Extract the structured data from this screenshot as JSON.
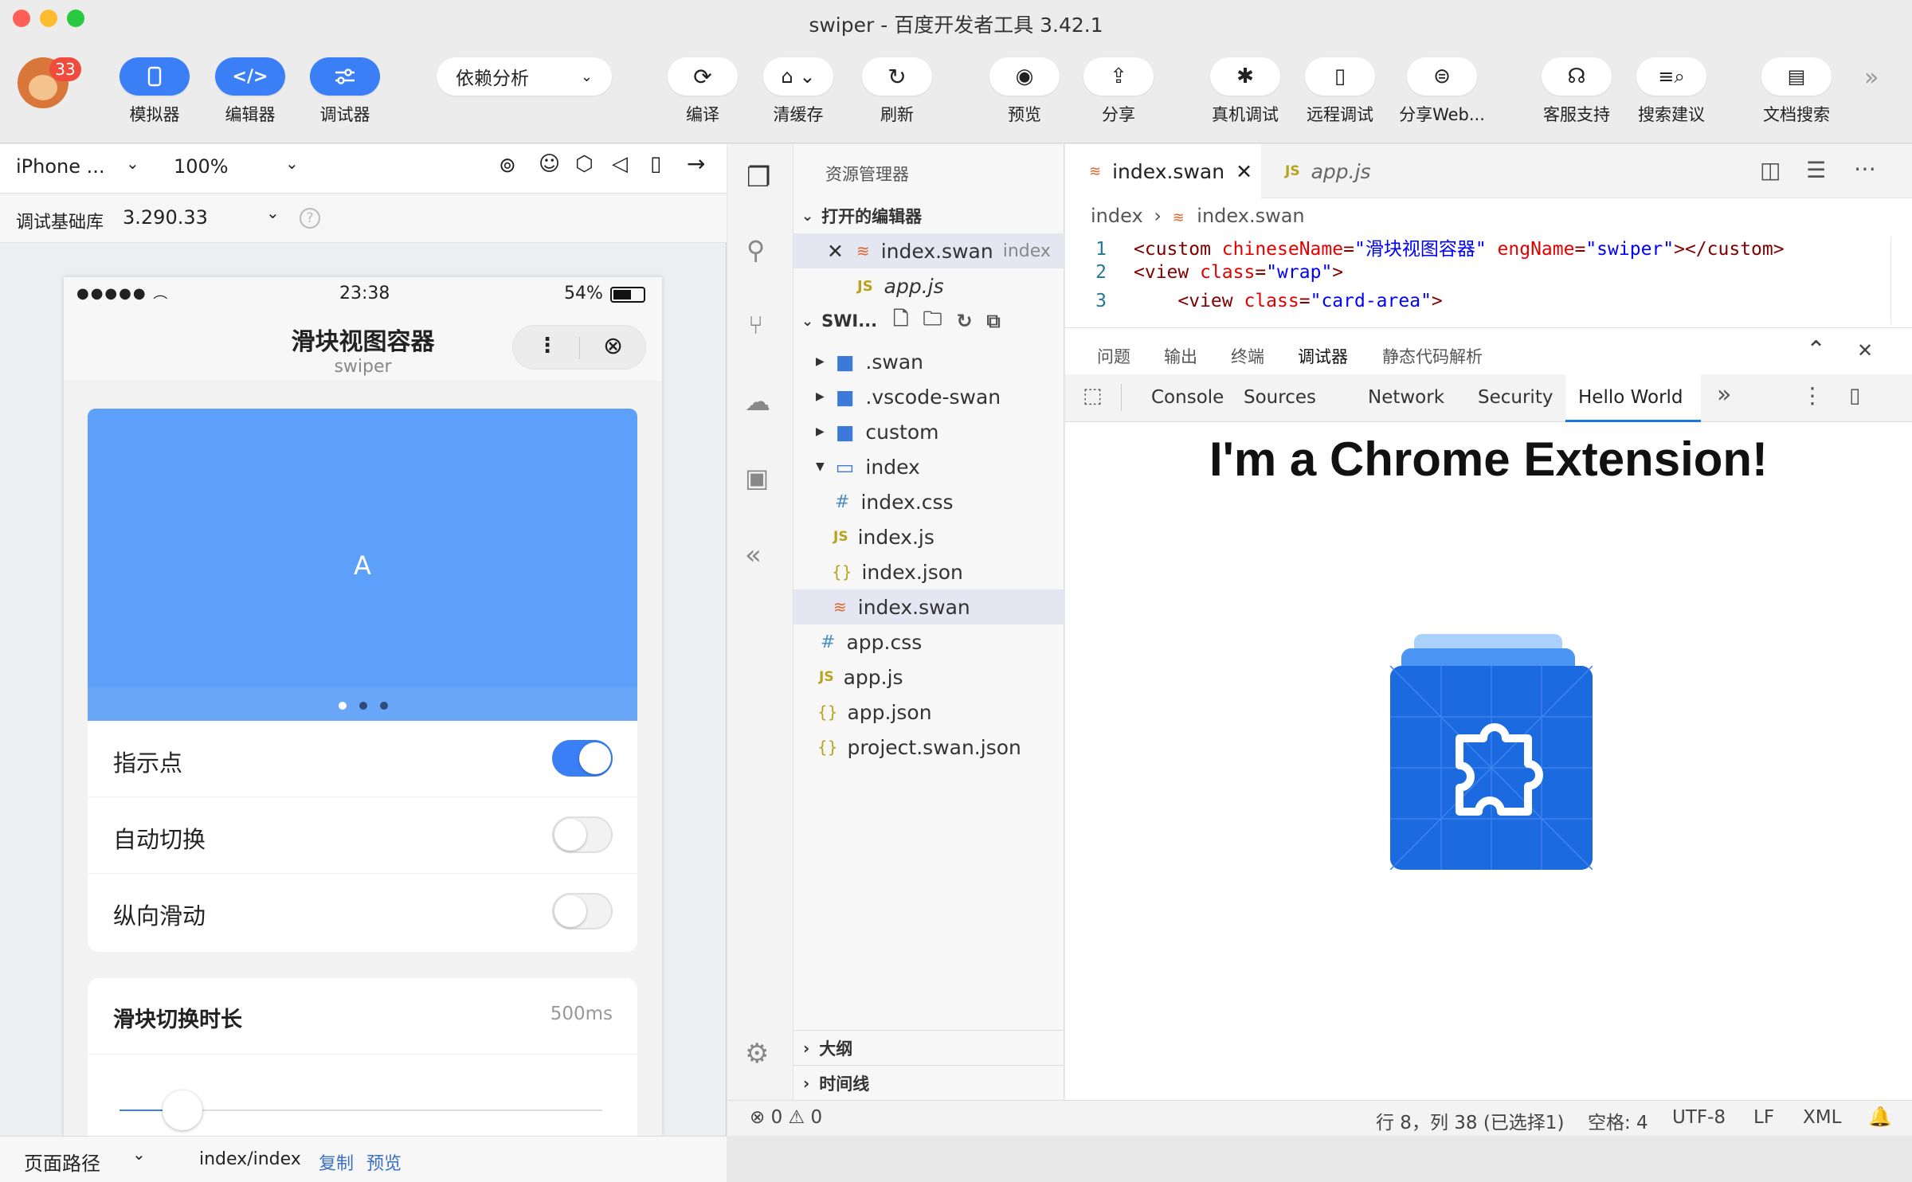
{
  "window": {
    "title": "swiper - 百度开发者工具 3.42.1",
    "badge": "33"
  },
  "toolbar": {
    "simulator": "模拟器",
    "editor": "编辑器",
    "debugger": "调试器",
    "dependency": "依赖分析",
    "compile": "编译",
    "clear_cache": "清缓存",
    "refresh": "刷新",
    "preview": "预览",
    "share": "分享",
    "real_debug": "真机调试",
    "remote_debug": "远程调试",
    "share_web": "分享Web...",
    "support": "客服支持",
    "search_suggest": "搜索建议",
    "doc_search": "文档搜索"
  },
  "simulator": {
    "device": "iPhone ...",
    "zoom": "100%",
    "base_lib_label": "调试基础库",
    "base_lib_version": "3.290.33",
    "status_time": "23:38",
    "battery": "54%",
    "nav_title": "滑块视图容器",
    "nav_subtitle": "swiper",
    "slide_label": "A",
    "switches": [
      {
        "label": "指示点",
        "on": true
      },
      {
        "label": "自动切换",
        "on": false
      },
      {
        "label": "纵向滑动",
        "on": false
      }
    ],
    "duration_label": "滑块切换时长",
    "duration_value": "500ms",
    "slider_fraction": 0.13
  },
  "bottombar": {
    "path_label": "页面路径",
    "path": "index/index",
    "copy": "复制",
    "preview": "预览"
  },
  "explorer": {
    "title": "资源管理器",
    "open_editors": "打开的编辑器",
    "open_files": [
      {
        "name": "index.swan",
        "hint": "index"
      },
      {
        "name": "app.js",
        "hint": ""
      }
    ],
    "project": "SWI...",
    "tree": [
      ".swan",
      ".vscode-swan",
      "custom",
      "index"
    ],
    "index_children": [
      "index.css",
      "index.js",
      "index.json",
      "index.swan"
    ],
    "root_files": [
      "app.css",
      "app.js",
      "app.json",
      "project.swan.json"
    ],
    "outline": "大纲",
    "timeline": "时间线"
  },
  "editor": {
    "tabs": [
      "index.swan",
      "app.js"
    ],
    "breadcrumb": [
      "index",
      "index.swan"
    ],
    "lines": [
      {
        "n": "1",
        "parts": [
          [
            "tag",
            "<custom "
          ],
          [
            "attr",
            "chineseName"
          ],
          [
            "tag",
            "="
          ],
          [
            "str",
            "\"滑块视图容器\""
          ],
          [
            "tag",
            " "
          ],
          [
            "attr",
            "engName"
          ],
          [
            "tag",
            "="
          ],
          [
            "str",
            "\"swiper\""
          ],
          [
            "tag",
            "></custom>"
          ]
        ]
      },
      {
        "n": "2",
        "parts": [
          [
            "tag",
            "<view "
          ],
          [
            "attr",
            "class"
          ],
          [
            "tag",
            "="
          ],
          [
            "str",
            "\"wrap\""
          ],
          [
            "tag",
            ">"
          ]
        ]
      },
      {
        "n": "3",
        "parts": [
          [
            "tag",
            "    <view "
          ],
          [
            "attr",
            "class"
          ],
          [
            "tag",
            "="
          ],
          [
            "str",
            "\"card-area\""
          ],
          [
            "tag",
            ">"
          ]
        ]
      }
    ]
  },
  "panel": {
    "tabs": [
      "问题",
      "输出",
      "终端",
      "调试器",
      "静态代码解析"
    ],
    "devtools_tabs": [
      "Console",
      "Sources",
      "Network",
      "Security",
      "Hello World"
    ],
    "heading": "I'm a Chrome Extension!"
  },
  "status": {
    "errors": "0",
    "warnings": "0",
    "position": "行 8，列 38 (已选择1)",
    "spaces": "空格: 4",
    "encoding": "UTF-8",
    "eol": "LF",
    "lang": "XML"
  }
}
